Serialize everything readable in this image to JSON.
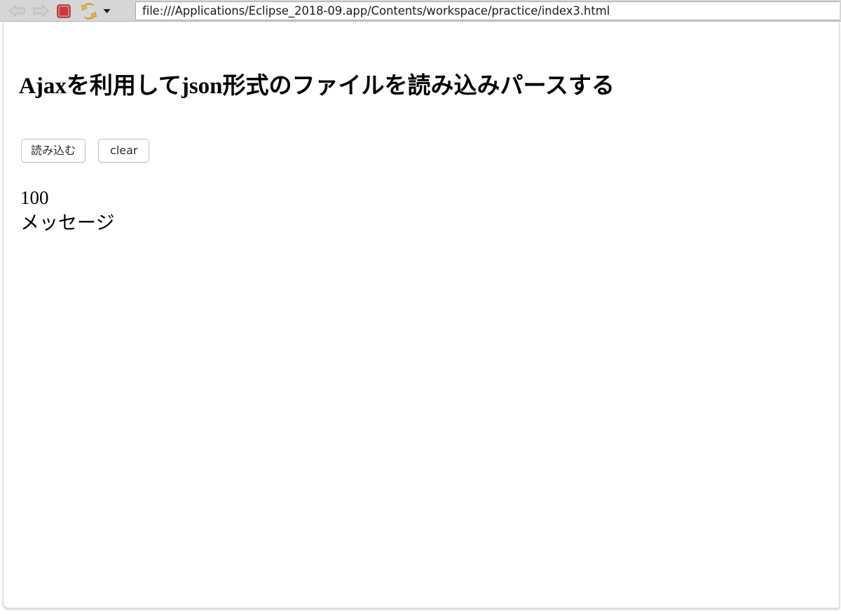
{
  "browser": {
    "toolbar": {
      "back_icon": "back-arrow-icon",
      "forward_icon": "forward-arrow-icon",
      "stop_icon": "stop-icon",
      "reload_icon": "reload-icon",
      "reload_dropdown_icon": "chevron-down-icon",
      "colors": {
        "toolbar_background": "#d6d6d6",
        "nav_arrow": "#cbcbcb",
        "stop_red": "#c93b3b",
        "reload_gold": "#f0c040"
      }
    },
    "address_bar": {
      "url": "file:///Applications/Eclipse_2018-09.app/Contents/workspace/practice/index3.html",
      "placeholder": "Enter address"
    }
  },
  "page": {
    "title": "Ajaxを利用してjson形式のファイルを読み込みパースする",
    "buttons": [
      {
        "label": "読み込む",
        "name": "load-button"
      },
      {
        "label": "clear",
        "name": "clear-button"
      }
    ],
    "output": {
      "lines": [
        "100",
        "メッセージ"
      ]
    }
  }
}
